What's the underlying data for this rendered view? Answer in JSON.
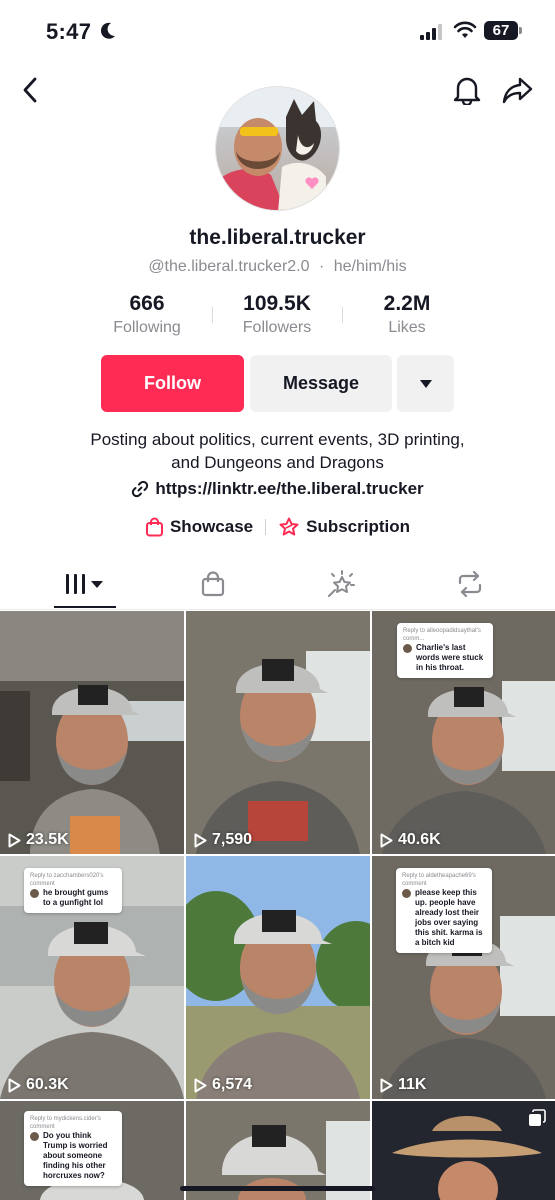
{
  "status_bar": {
    "time": "5:47",
    "battery": "67"
  },
  "header": {
    "back_icon": "chevron-left-icon",
    "bell_icon": "bell-icon",
    "share_icon": "share-arrow-icon"
  },
  "profile": {
    "display_name": "the.liberal.trucker",
    "handle": "@the.liberal.trucker2.0",
    "separator": "·",
    "pronouns": "he/him/his",
    "stats": [
      {
        "value": "666",
        "label": "Following"
      },
      {
        "value": "109.5K",
        "label": "Followers"
      },
      {
        "value": "2.2M",
        "label": "Likes"
      }
    ],
    "buttons": {
      "follow": "Follow",
      "message": "Message"
    },
    "bio_line1": "Posting about politics, current events, 3D printing,",
    "bio_line2": "and Dungeons and Dragons",
    "link": "https://linktr.ee/the.liberal.trucker",
    "showcase": "Showcase",
    "subscription": "Subscription"
  },
  "tabs": [
    {
      "icon": "videos-grid-icon",
      "active": true
    },
    {
      "icon": "shop-bag-icon",
      "active": false
    },
    {
      "icon": "liked-sparkle-icon",
      "active": false
    },
    {
      "icon": "repost-icon",
      "active": false
    }
  ],
  "videos": [
    {
      "views": "23.5K"
    },
    {
      "views": "7,590"
    },
    {
      "views": "40.6K",
      "reply_head": "Reply to alleoopadidsaythat's comm...",
      "reply_text": "Charlie's last words were stuck in his throat."
    },
    {
      "views": "60.3K",
      "reply_head": "Reply to zacchambers020's comment",
      "reply_text": "he brought gums to a gunfight lol"
    },
    {
      "views": "6,574"
    },
    {
      "views": "11K",
      "reply_head": "Reply to aldetheapache69's comment",
      "reply_text": "please keep this up. people have already lost their jobs over saying this shit. karma is a bitch kid"
    },
    {
      "views": "",
      "reply_head": "Reply to mydickens.cider's comment",
      "reply_text": "Do you think Trump is worried about someone finding his other horcruxes now?"
    },
    {
      "views": ""
    },
    {
      "views": ""
    }
  ],
  "colors": {
    "accent": "#fe2c55",
    "text": "#161823",
    "muted": "#8a8b91",
    "button_bg": "#f1f1f2"
  }
}
